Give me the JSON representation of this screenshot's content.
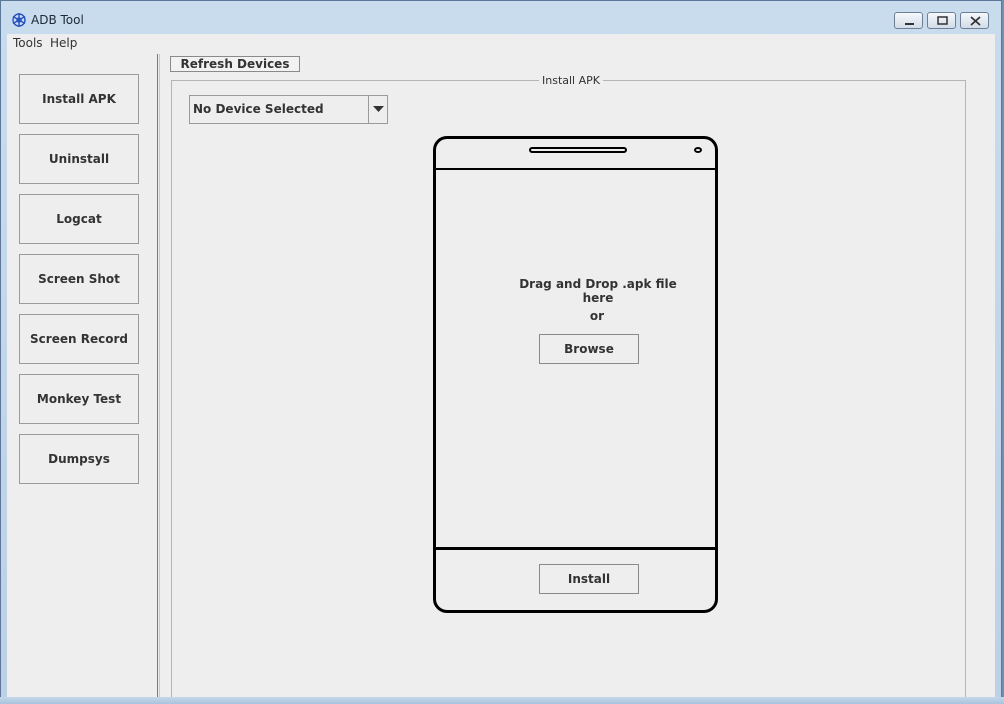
{
  "window": {
    "title": "ADB Tool",
    "accent": "#bcd0e6"
  },
  "menu": {
    "items": [
      "Tools",
      "Help"
    ]
  },
  "sidebar": {
    "items": [
      {
        "label": "Install APK"
      },
      {
        "label": "Uninstall"
      },
      {
        "label": "Logcat"
      },
      {
        "label": "Screen Shot"
      },
      {
        "label": "Screen Record"
      },
      {
        "label": "Monkey Test"
      },
      {
        "label": "Dumpsys"
      }
    ]
  },
  "toolbar": {
    "refresh_label": "Refresh Devices"
  },
  "install_panel": {
    "group_title": "Install APK",
    "device_select": {
      "value": "No Device Selected"
    },
    "drop_text": "Drag and Drop .apk file here",
    "or_text": "or",
    "browse_label": "Browse",
    "install_label": "Install"
  }
}
